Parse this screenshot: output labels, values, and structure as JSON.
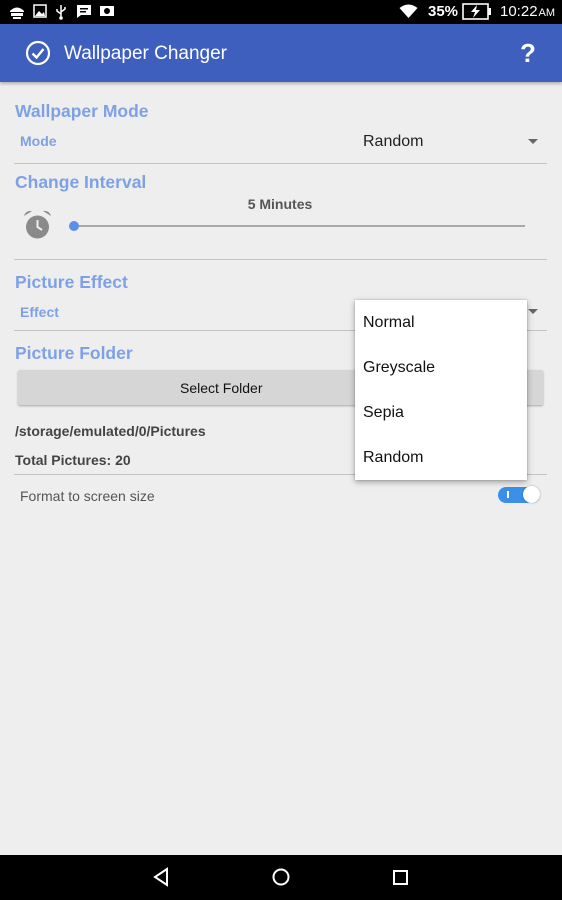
{
  "status_bar": {
    "battery_percent": "35%",
    "time": "10:22",
    "ampm": "AM"
  },
  "app_bar": {
    "title": "Wallpaper Changer",
    "help_label": "?"
  },
  "wallpaper_mode": {
    "section_title": "Wallpaper Mode",
    "label": "Mode",
    "value": "Random"
  },
  "change_interval": {
    "section_title": "Change Interval",
    "value": "5 Minutes",
    "slider_fraction": 0.0
  },
  "picture_effect": {
    "section_title": "Picture Effect",
    "label": "Effect",
    "options": [
      "Normal",
      "Greyscale",
      "Sepia",
      "Random"
    ]
  },
  "picture_folder": {
    "section_title": "Picture Folder",
    "button_label": "Select Folder",
    "path": "/storage/emulated/0/Pictures",
    "total_pictures": "Total Pictures: 20"
  },
  "format": {
    "label": "Format to screen size",
    "enabled": true
  },
  "colors": {
    "app_bar": "#3f5fbf",
    "section_title": "#7ea1e6",
    "accent": "#3b8fe6"
  },
  "icons": {
    "app_icon": "check-circle-icon",
    "alarm": "alarm-clock-icon"
  }
}
